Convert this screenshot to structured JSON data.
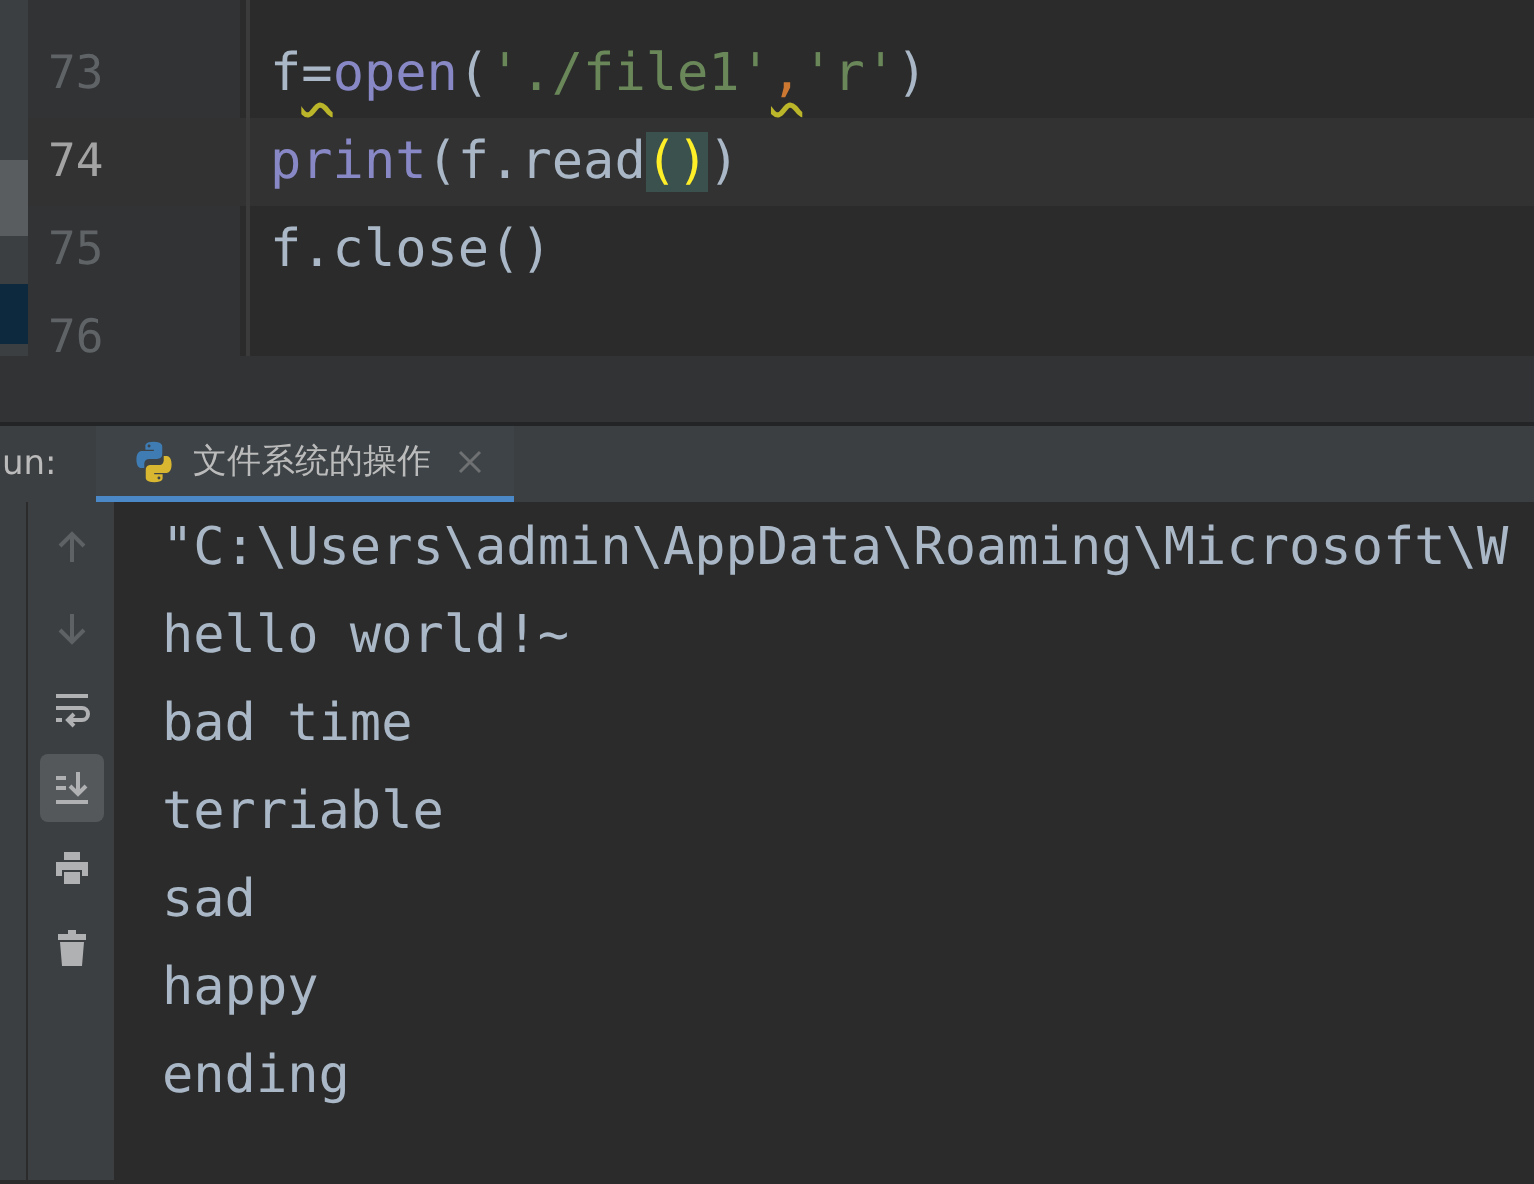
{
  "editor": {
    "lines": [
      {
        "number": "73",
        "current": false,
        "tokens": [
          {
            "text": "f",
            "kind": "plain",
            "warning": false
          },
          {
            "text": "=",
            "kind": "plain",
            "warning": true
          },
          {
            "text": "open",
            "kind": "builtin",
            "warning": false
          },
          {
            "text": "(",
            "kind": "plain",
            "warning": false
          },
          {
            "text": "'./file1'",
            "kind": "string",
            "warning": false
          },
          {
            "text": ",",
            "kind": "comma",
            "warning": true
          },
          {
            "text": "'r'",
            "kind": "string",
            "warning": false
          },
          {
            "text": ")",
            "kind": "plain",
            "warning": false
          }
        ]
      },
      {
        "number": "74",
        "current": true,
        "tokens": [
          {
            "text": "print",
            "kind": "builtin",
            "warning": false
          },
          {
            "text": "(f.read",
            "kind": "plain",
            "warning": false
          },
          {
            "text": "()",
            "kind": "matched",
            "warning": false
          },
          {
            "text": ")",
            "kind": "plain",
            "warning": false
          }
        ]
      },
      {
        "number": "75",
        "current": false,
        "tokens": [
          {
            "text": "f.close()",
            "kind": "plain",
            "warning": false
          }
        ]
      },
      {
        "number": "76",
        "current": false
      }
    ]
  },
  "run_panel": {
    "label": "un:",
    "tabs": [
      {
        "title": "文件系统的操作",
        "selected": true
      }
    ],
    "toolbar": [
      {
        "kind": "up",
        "disabled": true,
        "on": false
      },
      {
        "kind": "down",
        "disabled": true,
        "on": false
      },
      {
        "kind": "wrap",
        "disabled": false,
        "on": false
      },
      {
        "kind": "scroll-end",
        "disabled": false,
        "on": true
      },
      {
        "kind": "print",
        "disabled": false,
        "on": false
      },
      {
        "kind": "trash",
        "disabled": false,
        "on": false
      }
    ],
    "output": [
      "\"C:\\Users\\admin\\AppData\\Roaming\\Microsoft\\W",
      "hello world!~",
      "bad time",
      "terriable",
      "sad",
      "happy",
      "ending"
    ]
  }
}
